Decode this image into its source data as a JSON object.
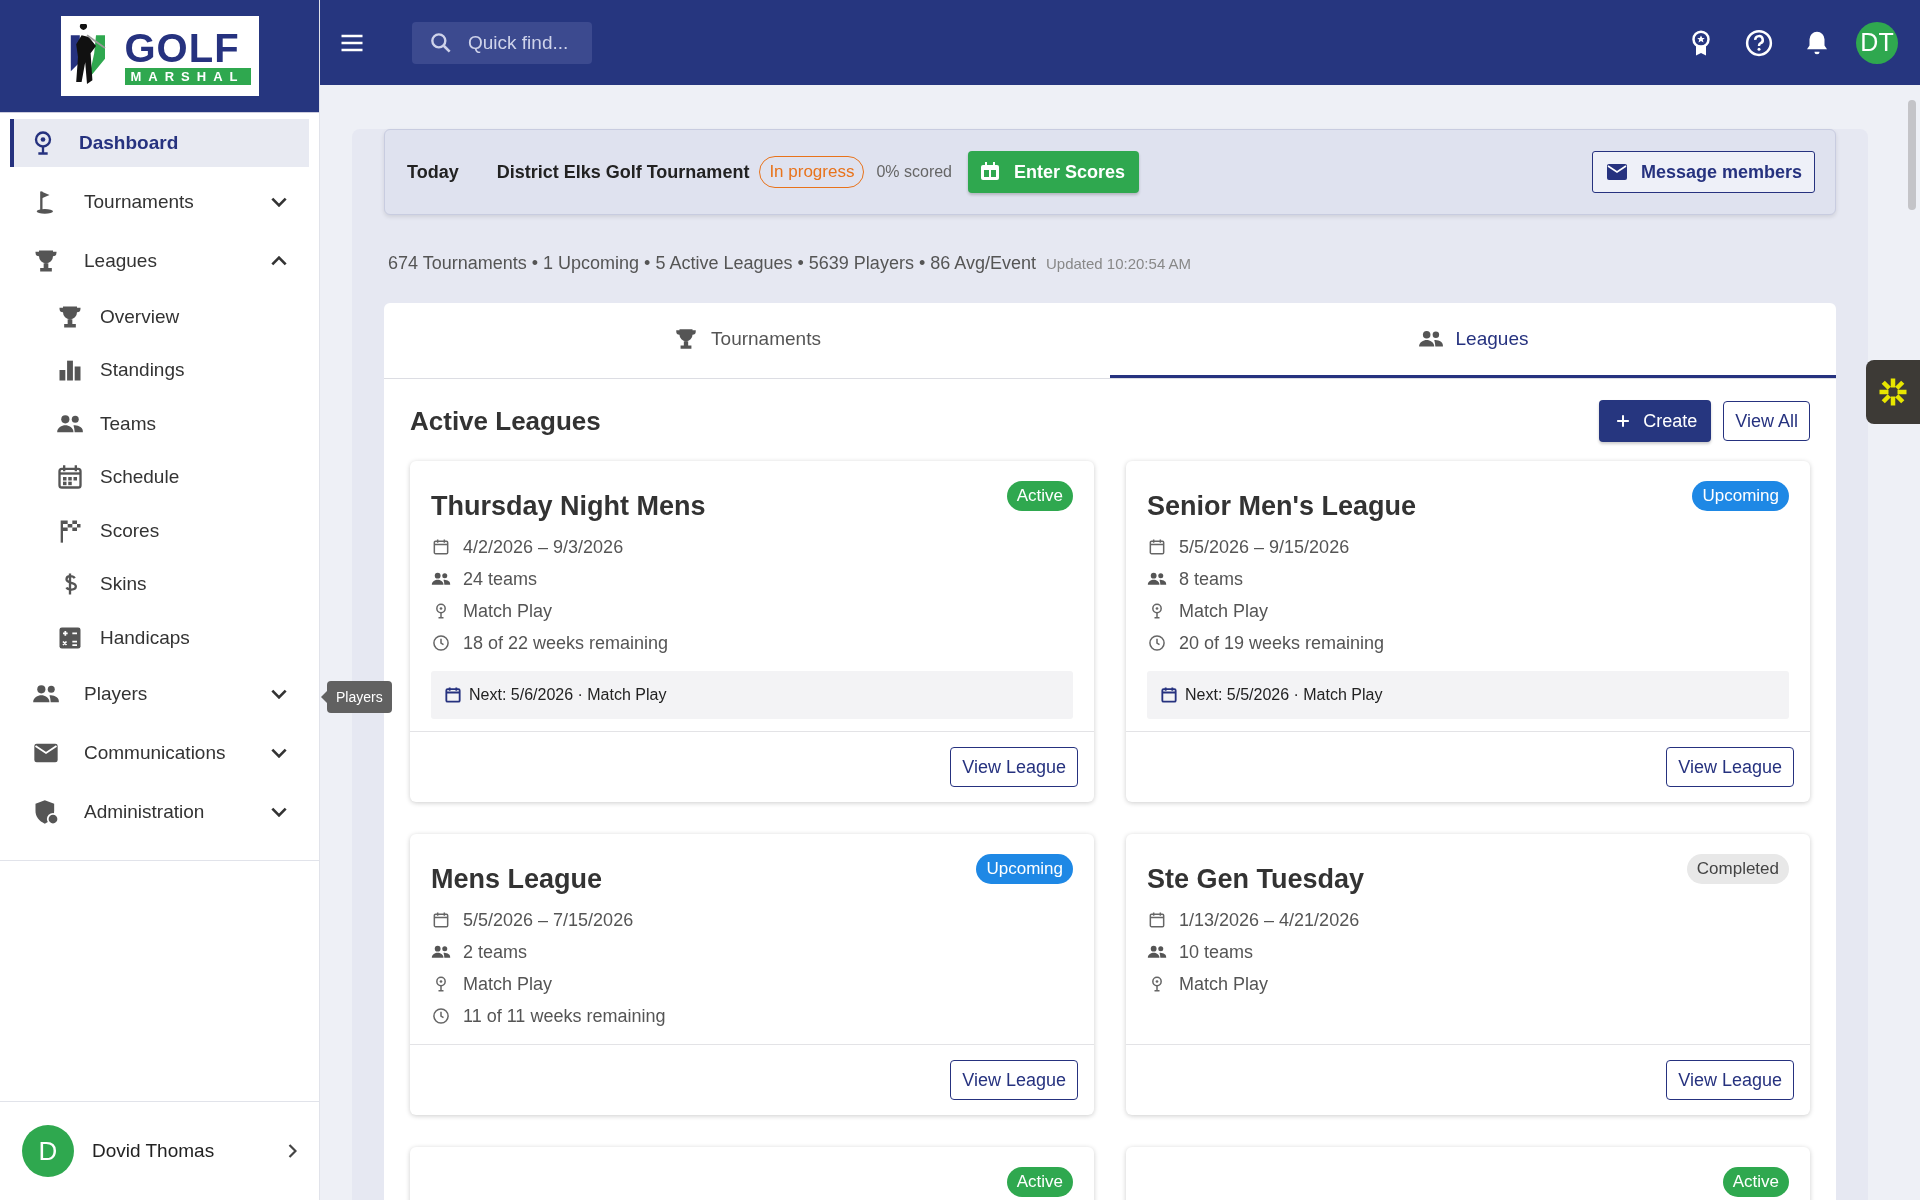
{
  "logo": {
    "word": "GOLF",
    "sub": "MARSHAL"
  },
  "topbar": {
    "search": {
      "placeholder": "Quick find..."
    },
    "avatar": "DT"
  },
  "sidebar": {
    "items": [
      {
        "label": "Dashboard",
        "selected": true
      },
      {
        "label": "Tournaments",
        "selected": false,
        "expanded": false
      },
      {
        "label": "Leagues",
        "selected": false,
        "expanded": true,
        "children": [
          {
            "label": "Overview",
            "selected": false
          },
          {
            "label": "Standings",
            "selected": false
          },
          {
            "label": "Teams",
            "selected": false
          },
          {
            "label": "Schedule",
            "selected": false
          },
          {
            "label": "Scores",
            "selected": false
          },
          {
            "label": "Skins",
            "selected": false
          },
          {
            "label": "Handicaps",
            "selected": false
          }
        ]
      },
      {
        "label": "Players",
        "selected": false,
        "expanded": false
      },
      {
        "label": "Communications",
        "selected": false,
        "expanded": false
      },
      {
        "label": "Administration",
        "selected": false,
        "expanded": false
      }
    ],
    "user": {
      "initial": "D",
      "name": "Dovid Thomas"
    }
  },
  "tooltip": "Players",
  "today": {
    "label": "Today",
    "event": "District Elks Golf Tournament",
    "status": "In progress",
    "scored": "0% scored",
    "enter": "Enter Scores",
    "message": "Message members"
  },
  "stats": {
    "text": "674 Tournaments • 1 Upcoming • 5 Active Leagues • 5639 Players • 86 Avg/Event",
    "updated": "Updated 10:20:54 AM"
  },
  "tabs": [
    {
      "label": "Tournaments",
      "selected": false
    },
    {
      "label": "Leagues",
      "selected": true
    }
  ],
  "section": {
    "title": "Active Leagues",
    "create": "Create",
    "view_all": "View All"
  },
  "leagues": [
    {
      "name": "Thursday Night Mens",
      "status": "Active",
      "kind": "active",
      "details": [
        {
          "kind": "dates",
          "text": "4/2/2026 – 9/3/2026"
        },
        {
          "kind": "teams",
          "text": "24 teams"
        },
        {
          "kind": "format",
          "text": "Match Play"
        },
        {
          "kind": "remaining",
          "text": "18 of 22 weeks remaining"
        }
      ],
      "next": "Next: 5/6/2026 · Match Play",
      "action": "View League"
    },
    {
      "name": "Senior Men's League",
      "status": "Upcoming",
      "kind": "upcoming",
      "details": [
        {
          "kind": "dates",
          "text": "5/5/2026 – 9/15/2026"
        },
        {
          "kind": "teams",
          "text": "8 teams"
        },
        {
          "kind": "format",
          "text": "Match Play"
        },
        {
          "kind": "remaining",
          "text": "20 of 19 weeks remaining"
        }
      ],
      "next": "Next: 5/5/2026 · Match Play",
      "action": "View League"
    },
    {
      "name": "Mens League",
      "status": "Upcoming",
      "kind": "upcoming",
      "details": [
        {
          "kind": "dates",
          "text": "5/5/2026 – 7/15/2026"
        },
        {
          "kind": "teams",
          "text": "2 teams"
        },
        {
          "kind": "format",
          "text": "Match Play"
        },
        {
          "kind": "remaining",
          "text": "11 of 11 weeks remaining"
        }
      ],
      "action": "View League"
    },
    {
      "name": "Ste Gen Tuesday",
      "status": "Completed",
      "kind": "completed",
      "details": [
        {
          "kind": "dates",
          "text": "1/13/2026 – 4/21/2026"
        },
        {
          "kind": "teams",
          "text": "10 teams"
        },
        {
          "kind": "format",
          "text": "Match Play"
        }
      ],
      "action": "View League"
    },
    {
      "status": "Active",
      "kind": "active"
    },
    {
      "status": "Active",
      "kind": "active"
    }
  ]
}
